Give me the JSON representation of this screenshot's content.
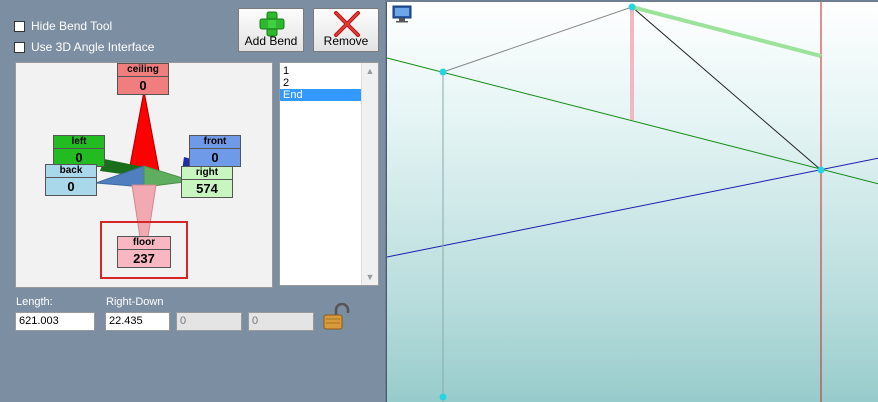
{
  "options": {
    "hide_bend_tool": "Hide Bend Tool",
    "use_3d_angle": "Use 3D Angle Interface"
  },
  "buttons": {
    "add_bend": "Add Bend",
    "remove": "Remove"
  },
  "directions": {
    "ceiling": {
      "label": "ceiling",
      "value": "0"
    },
    "left": {
      "label": "left",
      "value": "0"
    },
    "front": {
      "label": "front",
      "value": "0"
    },
    "back": {
      "label": "back",
      "value": "0"
    },
    "right": {
      "label": "right",
      "value": "574"
    },
    "floor": {
      "label": "floor",
      "value": "237"
    }
  },
  "bend_list": {
    "items": [
      "1",
      "2",
      "End"
    ],
    "selected": "End"
  },
  "fields": {
    "length_label": "Length:",
    "length_value": "621.003",
    "direction_label": "Right-Down",
    "direction_value": "22.435",
    "value2": "0",
    "value3": "0"
  },
  "colors": {
    "ceiling": "#f07e7e",
    "left": "#22bb22",
    "front": "#6f9ae8",
    "back": "#a9d8ea",
    "right": "#c8f5c0",
    "floor": "#f8b7c1",
    "highlight": "#d6262a",
    "list_selection": "#3399ff"
  }
}
